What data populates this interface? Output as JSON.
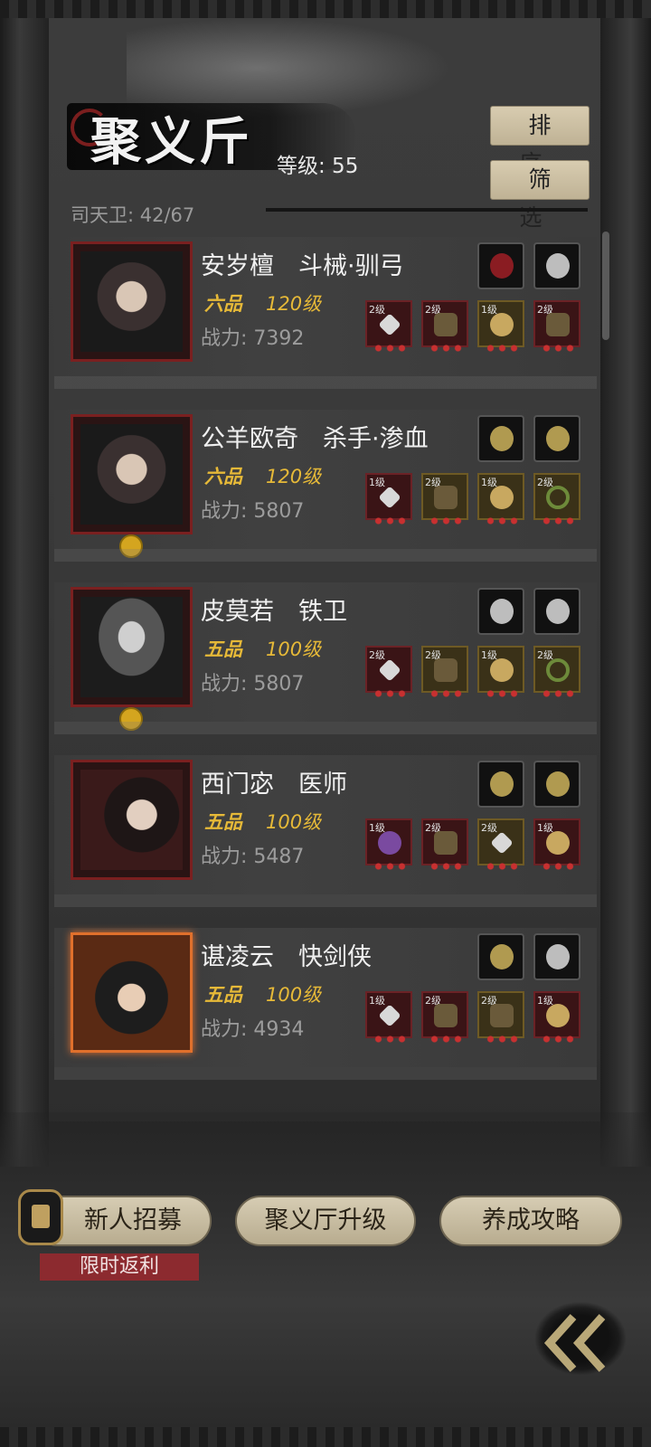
{
  "header": {
    "title": "聚义斤",
    "level_label": "等级: 55",
    "sort_label": "排序",
    "filter_label": "筛选",
    "guard_count": "司天卫: 42/67"
  },
  "heroes": [
    {
      "name": "安岁檀　斗械·驯弓",
      "rank": "六品",
      "level": "120级",
      "power": "战力: 7392",
      "equip_levels": [
        "2级",
        "2级",
        "1级",
        "2级"
      ]
    },
    {
      "name": "公羊欧奇　杀手·渗血",
      "rank": "六品",
      "level": "120级",
      "power": "战力: 5807",
      "equip_levels": [
        "1级",
        "2级",
        "1级",
        "2级"
      ]
    },
    {
      "name": "皮莫若　铁卫",
      "rank": "五品",
      "level": "100级",
      "power": "战力: 5807",
      "equip_levels": [
        "2级",
        "2级",
        "1级",
        "2级"
      ]
    },
    {
      "name": "西门宓　医师",
      "rank": "五品",
      "level": "100级",
      "power": "战力: 5487",
      "equip_levels": [
        "1级",
        "2级",
        "2级",
        "1级"
      ]
    },
    {
      "name": "谌凌云　快剑侠",
      "rank": "五品",
      "level": "100级",
      "power": "战力: 4934",
      "equip_levels": [
        "1级",
        "2级",
        "2级",
        "1级"
      ]
    }
  ],
  "footer": {
    "recruit_label": "新人招募",
    "upgrade_label": "聚义厅升级",
    "guide_label": "养成攻略",
    "limited_tag": "限时返利",
    "back_icon": "double-chevron-left-icon"
  }
}
